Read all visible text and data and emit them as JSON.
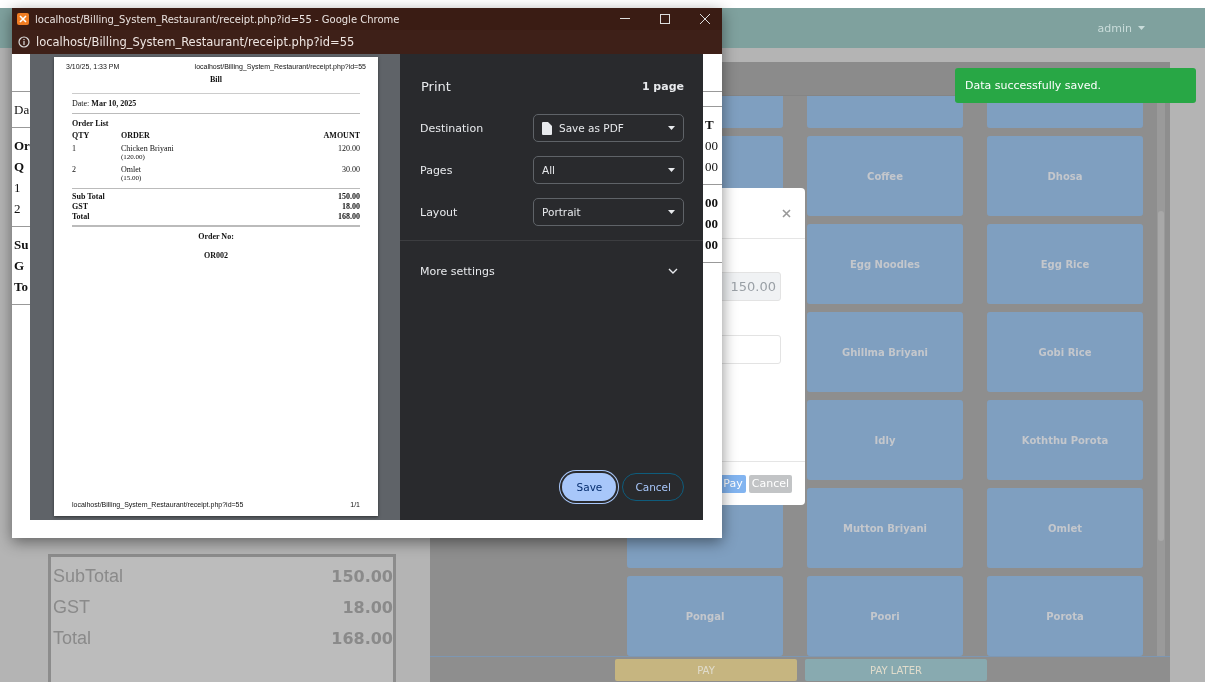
{
  "browser_window": {
    "title": "localhost/Billing_System_Restaurant/receipt.php?id=55 - Google Chrome",
    "url": "localhost/Billing_System_Restaurant/receipt.php?id=55"
  },
  "page_behind": {
    "left_fragments": [
      {
        "kind": "rule"
      },
      {
        "kind": "text",
        "text": "Da",
        "bold": false
      },
      {
        "kind": "rule"
      },
      {
        "kind": "text",
        "text": "Or",
        "bold": true
      },
      {
        "kind": "text",
        "text": "Q",
        "bold": true
      },
      {
        "kind": "text",
        "text": "1",
        "bold": false
      },
      {
        "kind": "text",
        "text": "2",
        "bold": false
      },
      {
        "kind": "rule"
      },
      {
        "kind": "text",
        "text": "Su",
        "bold": true
      },
      {
        "kind": "text",
        "text": "G",
        "bold": true
      },
      {
        "kind": "text",
        "text": "To",
        "bold": true
      },
      {
        "kind": "rule"
      }
    ],
    "right_fragments": [
      {
        "kind": "rule"
      },
      {
        "kind": "rule"
      },
      {
        "kind": "text",
        "text": "T",
        "bold": true
      },
      {
        "kind": "text",
        "text": "00",
        "bold": false
      },
      {
        "kind": "text",
        "text": "00",
        "bold": false
      },
      {
        "kind": "rule"
      },
      {
        "kind": "text",
        "text": "00",
        "bold": true
      },
      {
        "kind": "text",
        "text": "00",
        "bold": true
      },
      {
        "kind": "text",
        "text": "00",
        "bold": true
      },
      {
        "kind": "rule"
      }
    ]
  },
  "print_preview": {
    "header_left": "3/10/25, 1:33 PM",
    "header_right": "localhost/Billing_System_Restaurant/receipt.php?id=55",
    "title": "Bill",
    "date": "Date: **Mar 10, 2025**",
    "section": "Order List",
    "columns": [
      "QTY",
      "ORDER",
      "AMOUNT"
    ],
    "rows": [
      {
        "qty": "1",
        "order": "Chicken Briyani",
        "price": "(120.00)",
        "amount": "120.00"
      },
      {
        "qty": "2",
        "order": "Omlet",
        "price": "(15.00)",
        "amount": "30.00"
      }
    ],
    "totals": [
      {
        "label": "Sub Total",
        "value": "150.00"
      },
      {
        "label": "GST",
        "value": "18.00"
      },
      {
        "label": "Total",
        "value": "168.00"
      }
    ],
    "order_label": "Order No:",
    "order_no": "OR002",
    "footer_left": "localhost/Billing_System_Restaurant/receipt.php?id=55",
    "footer_right": "1/1"
  },
  "print_settings": {
    "title": "Print",
    "pages_count": "1 page",
    "fields": [
      {
        "label": "Destination",
        "value": "Save as PDF",
        "kind": "file"
      },
      {
        "label": "Pages",
        "value": "All",
        "kind": "plain"
      },
      {
        "label": "Layout",
        "value": "Portrait",
        "kind": "plain"
      }
    ],
    "more": {
      "label": "More settings",
      "expanded": false
    },
    "buttons": [
      {
        "label": "Save",
        "kind": "primary"
      },
      {
        "label": "Cancel",
        "kind": "secondary"
      }
    ]
  },
  "app": {
    "user": "admin",
    "totals": [
      {
        "label": "SubTotal",
        "value": "150.00"
      },
      {
        "label": "GST",
        "value": "18.00"
      },
      {
        "label": "Total",
        "value": "168.00"
      }
    ],
    "menu_items": [
      {
        "kind": "blank"
      },
      {
        "kind": "blank"
      },
      {
        "kind": "blank"
      },
      {
        "kind": "blank"
      },
      {
        "kind": "item",
        "label": "Coffee"
      },
      {
        "kind": "item",
        "label": "Dhosa"
      },
      {
        "kind": "covered"
      },
      {
        "kind": "item",
        "label": "Egg Noodles"
      },
      {
        "kind": "item",
        "label": "Egg Rice"
      },
      {
        "kind": "covered"
      },
      {
        "kind": "item",
        "label": "Ghillma Briyani"
      },
      {
        "kind": "item",
        "label": "Gobi Rice"
      },
      {
        "kind": "covered"
      },
      {
        "kind": "item",
        "label": "Idly"
      },
      {
        "kind": "item",
        "label": "Koththu Porota"
      },
      {
        "kind": "blank"
      },
      {
        "kind": "item",
        "label": "Mutton Briyani"
      },
      {
        "kind": "item",
        "label": "Omlet"
      },
      {
        "kind": "item",
        "label": "Pongal"
      },
      {
        "kind": "item",
        "label": "Poori"
      },
      {
        "kind": "item",
        "label": "Porota"
      }
    ],
    "actions": [
      {
        "label": "PAY",
        "kind": "pay"
      },
      {
        "label": "PAY LATER",
        "kind": "later"
      }
    ]
  },
  "payment_modal": {
    "amount": "150.00",
    "buttons": [
      {
        "label": "Pay",
        "kind": "primary"
      },
      {
        "label": "Cancel",
        "kind": "secondary"
      }
    ]
  },
  "toast": {
    "message": "Data successfully saved."
  }
}
